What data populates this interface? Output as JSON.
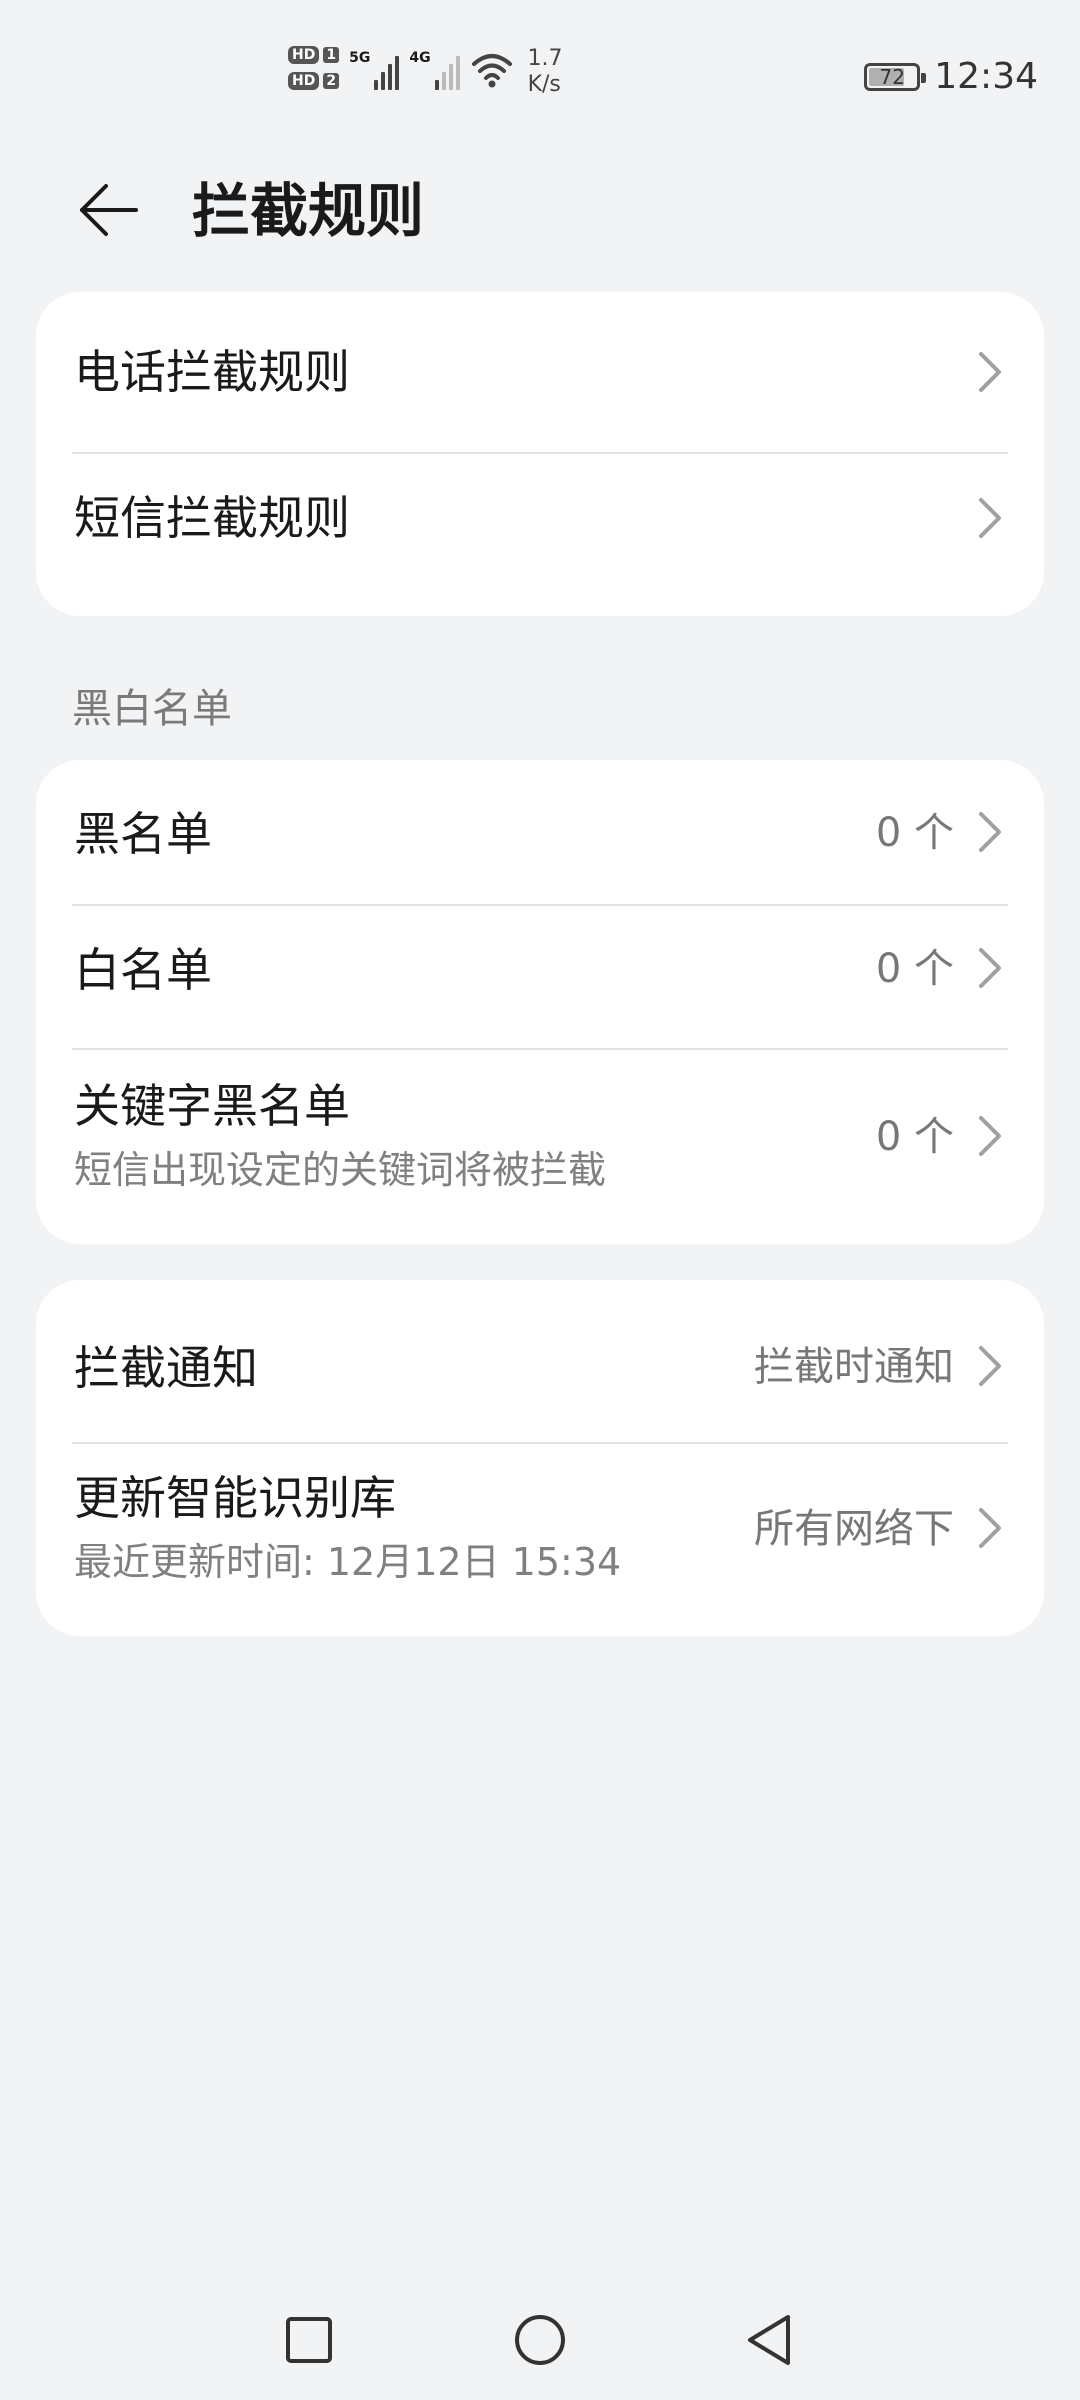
{
  "status_bar": {
    "hd1": "HD",
    "hd1_num": "1",
    "hd2": "HD",
    "hd2_num": "2",
    "sim1_net": "5G",
    "sim2_net": "4G",
    "speed_value": "1.7",
    "speed_unit": "K/s",
    "battery_level": "72",
    "time": "12:34"
  },
  "header": {
    "title": "拦截规则"
  },
  "rules_card": {
    "items": [
      {
        "label": "电话拦截规则"
      },
      {
        "label": "短信拦截规则"
      }
    ]
  },
  "lists_section": {
    "label": "黑白名单",
    "items": [
      {
        "label": "黑名单",
        "value": "0 个"
      },
      {
        "label": "白名单",
        "value": "0 个"
      },
      {
        "label": "关键字黑名单",
        "sub": "短信出现设定的关键词将被拦截",
        "value": "0 个"
      }
    ]
  },
  "settings_card": {
    "items": [
      {
        "label": "拦截通知",
        "value": "拦截时通知"
      },
      {
        "label": "更新智能识别库",
        "sub": "最近更新时间: 12月12日 15:34",
        "value": "所有网络下"
      }
    ]
  },
  "icons": {
    "back": "arrow-left-icon",
    "chevron": "chevron-right-icon",
    "recents": "square-icon",
    "home": "circle-icon",
    "back_nav": "triangle-back-icon"
  },
  "colors": {
    "background": "#f1f3f5",
    "card": "#ffffff",
    "text_primary": "#1a1a1a",
    "text_secondary": "#808080"
  }
}
